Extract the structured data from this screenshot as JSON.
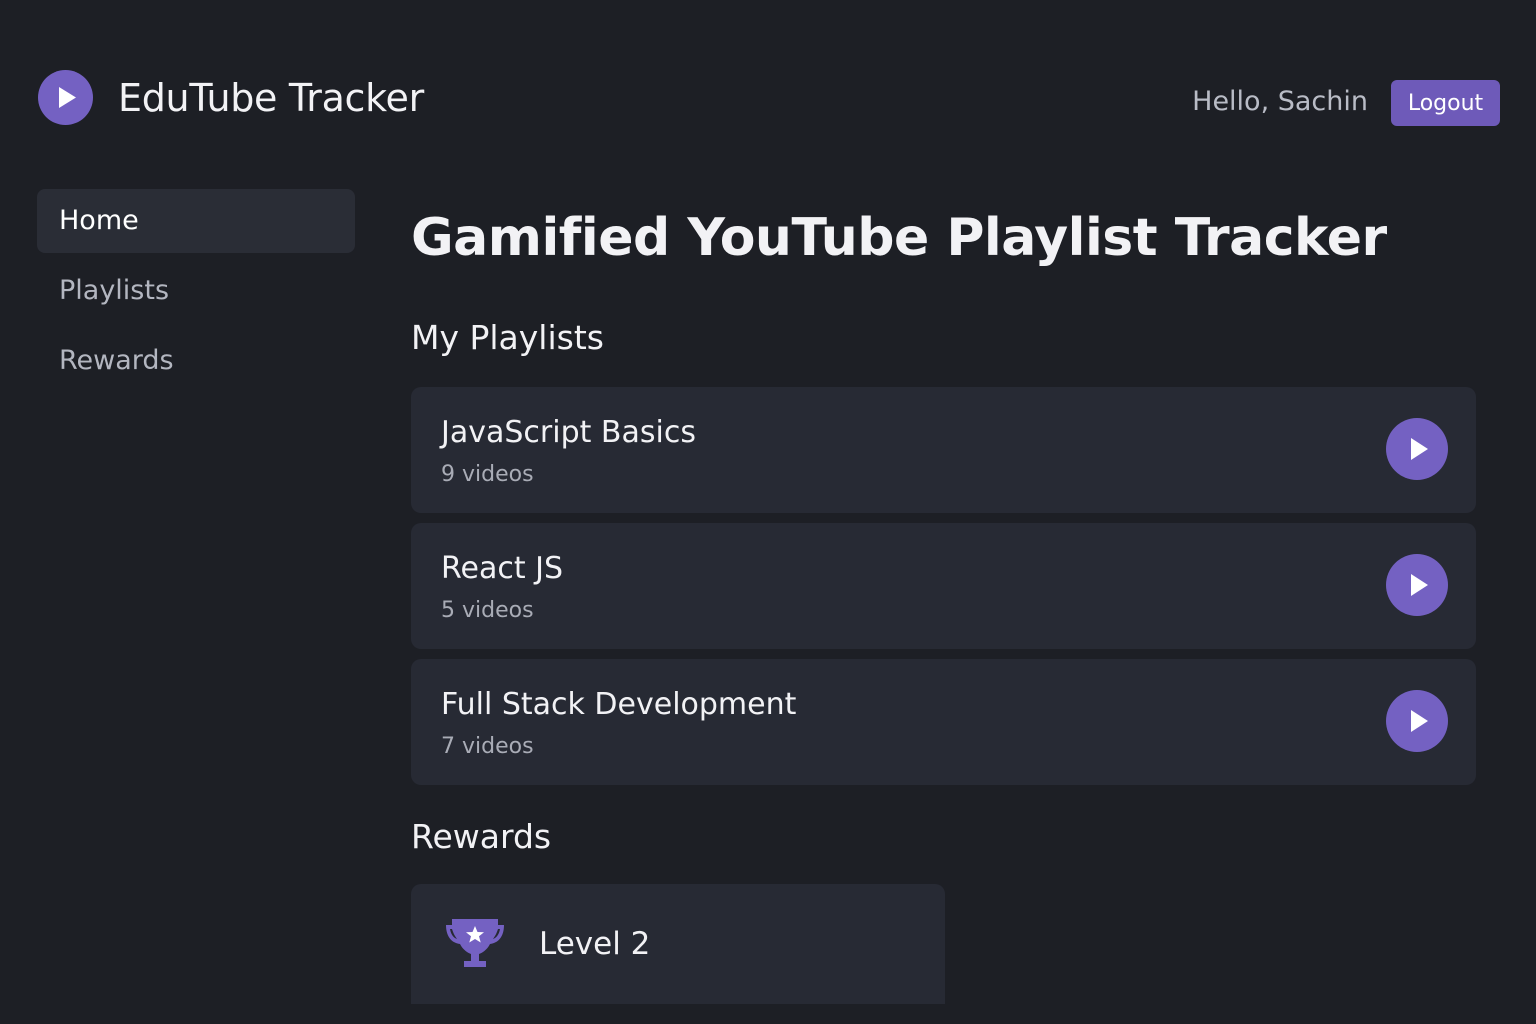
{
  "header": {
    "app_title": "EduTube Tracker",
    "greeting": "Hello, Sachin",
    "logout_label": "Logout",
    "logo_icon": "play-icon"
  },
  "sidebar": {
    "items": [
      {
        "label": "Home",
        "active": true
      },
      {
        "label": "Playlists",
        "active": false
      },
      {
        "label": "Rewards",
        "active": false
      }
    ]
  },
  "main": {
    "page_title": "Gamified YouTube Playlist Tracker",
    "playlists_heading": "My Playlists",
    "playlists": [
      {
        "name": "JavaScript Basics",
        "count": "9 videos"
      },
      {
        "name": "React JS",
        "count": "5 videos"
      },
      {
        "name": "Full Stack Development",
        "count": "7 videos"
      }
    ],
    "rewards_heading": "Rewards",
    "rewards": [
      {
        "label": "Level 2",
        "icon": "trophy-icon"
      }
    ]
  },
  "colors": {
    "background": "#1d1f25",
    "card": "#272a34",
    "accent": "#7461c2",
    "button": "#6e5ab9"
  }
}
